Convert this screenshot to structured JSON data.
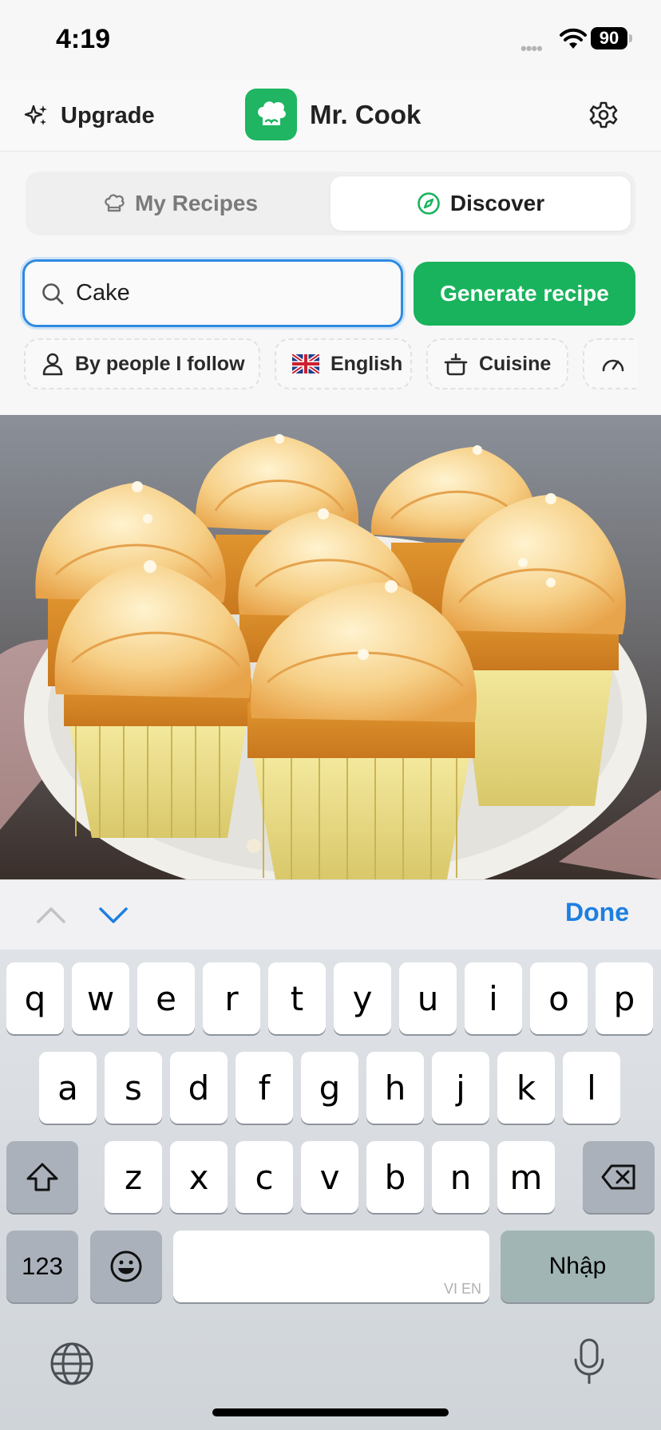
{
  "status_bar": {
    "time": "4:19",
    "battery": "90"
  },
  "header": {
    "upgrade_label": "Upgrade",
    "app_name": "Mr. Cook"
  },
  "tabs": [
    {
      "label": "My Recipes",
      "selected": false
    },
    {
      "label": "Discover",
      "selected": true
    }
  ],
  "search": {
    "value": "Cake"
  },
  "generate_button": {
    "label": "Generate recipe"
  },
  "filters": [
    {
      "label": "By people I follow",
      "icon": "person-icon"
    },
    {
      "label": "English",
      "icon": "uk-flag-icon"
    },
    {
      "label": "Cuisine",
      "icon": "pot-icon"
    },
    {
      "label": "",
      "icon": "gauge-icon"
    }
  ],
  "keyboard": {
    "done_label": "Done",
    "row1": [
      "q",
      "w",
      "e",
      "r",
      "t",
      "y",
      "u",
      "i",
      "o",
      "p"
    ],
    "row2": [
      "a",
      "s",
      "d",
      "f",
      "g",
      "h",
      "j",
      "k",
      "l"
    ],
    "row3": [
      "z",
      "x",
      "c",
      "v",
      "b",
      "n",
      "m"
    ],
    "numbers_label": "123",
    "enter_label": "Nhập",
    "space_hint": "VI EN"
  },
  "colors": {
    "accent_green": "#19b35d",
    "link_blue": "#1d7fe0"
  }
}
